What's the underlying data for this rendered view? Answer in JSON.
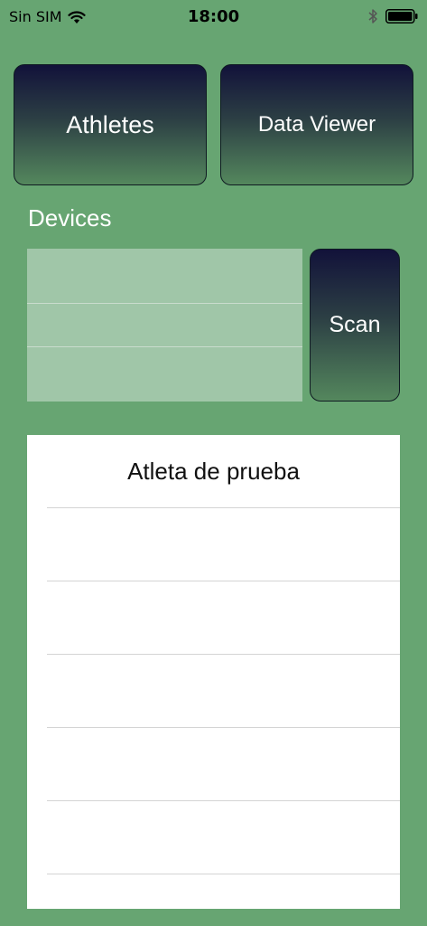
{
  "status_bar": {
    "carrier": "Sin SIM",
    "time": "18:00",
    "icons": [
      "wifi-icon",
      "bluetooth-icon",
      "battery-icon"
    ]
  },
  "nav_buttons": {
    "athletes_label": "Athletes",
    "data_viewer_label": "Data Viewer"
  },
  "devices": {
    "label": "Devices",
    "rows": [
      "",
      "",
      ""
    ],
    "scan_label": "Scan"
  },
  "athletes": {
    "rows": [
      "Atleta de prueba",
      "",
      "",
      "",
      "",
      ""
    ]
  },
  "colors": {
    "background": "#67a572",
    "button_gradient_top": "#12123a",
    "button_gradient_bottom": "#54875d",
    "device_list_bg": "#a0c6a8",
    "panel_bg": "#ffffff"
  }
}
